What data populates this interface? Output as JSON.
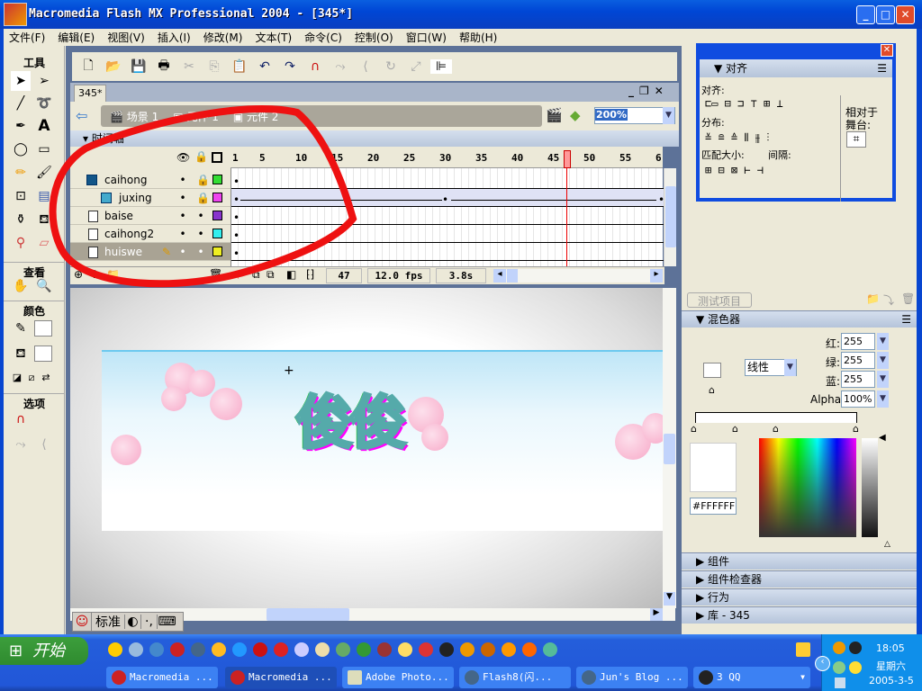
{
  "window": {
    "title": "Macromedia Flash MX Professional 2004 - [345*]",
    "minimize": "_",
    "maximize": "□",
    "close": "✕"
  },
  "menu": [
    "文件(F)",
    "编辑(E)",
    "视图(V)",
    "插入(I)",
    "修改(M)",
    "文本(T)",
    "命令(C)",
    "控制(O)",
    "窗口(W)",
    "帮助(H)"
  ],
  "tools": {
    "title": "工具",
    "view_title": "查看",
    "color_title": "颜色",
    "options_title": "选项"
  },
  "toolbar": [
    "new",
    "open",
    "save",
    "print",
    "cut",
    "copy",
    "paste",
    "undo",
    "redo",
    "snap",
    "smooth",
    "straighten",
    "rotate",
    "scale",
    "align"
  ],
  "document": {
    "tab": "345*",
    "breadcrumbs": [
      "场景 1",
      "元件 1",
      "元件 2"
    ],
    "zoom": "200%"
  },
  "timeline": {
    "title": "时间轴",
    "ruler": [
      "1",
      "5",
      "10",
      "15",
      "20",
      "25",
      "30",
      "35",
      "40",
      "45",
      "50",
      "55",
      "6"
    ],
    "layers": [
      {
        "name": "caihong",
        "color": "#33dd33",
        "locked": true,
        "type": "mask"
      },
      {
        "name": "juxing",
        "color": "#ee44ee",
        "locked": true,
        "type": "masked"
      },
      {
        "name": "baise",
        "color": "#8833cc",
        "locked": false,
        "type": "normal"
      },
      {
        "name": "caihong2",
        "color": "#33eeee",
        "locked": false,
        "type": "normal"
      },
      {
        "name": "huiswe",
        "color": "#eeee22",
        "locked": false,
        "type": "normal",
        "selected": true
      }
    ],
    "current_frame": "47",
    "fps": "12.0 fps",
    "elapsed": "3.8s"
  },
  "stage": {
    "text": "俊俊"
  },
  "ime": {
    "mode": "标准"
  },
  "align_panel": {
    "title": "对齐",
    "align_label": "对齐:",
    "distribute_label": "分布:",
    "match_size_label": "匹配大小:",
    "spacing_label": "间隔:",
    "relative_label": "相对于",
    "stage_label": "舞台:"
  },
  "panels": {
    "test_items": "测试项目",
    "mixer": {
      "title": "混色器",
      "type": "线性",
      "red_label": "红:",
      "red": "255",
      "green_label": "绿:",
      "green": "255",
      "blue_label": "蓝:",
      "blue": "255",
      "alpha_label": "Alpha:",
      "alpha": "100%",
      "hex": "#FFFFFF"
    },
    "collapsed": [
      "组件",
      "组件检查器",
      "行为",
      "库 - 345"
    ]
  },
  "taskbar": {
    "start": "开始",
    "tasks": [
      "Macromedia ...",
      "Macromedia ...",
      "Adobe Photo...",
      "Flash8(闪...",
      "Jun's Blog ...",
      "3 QQ"
    ],
    "time": "18:05",
    "weekday": "星期六",
    "date": "2005-3-5"
  },
  "colors": {
    "accent": "#0f4ce0",
    "annotation": "#ee1111",
    "playhead": "#ee0000"
  }
}
